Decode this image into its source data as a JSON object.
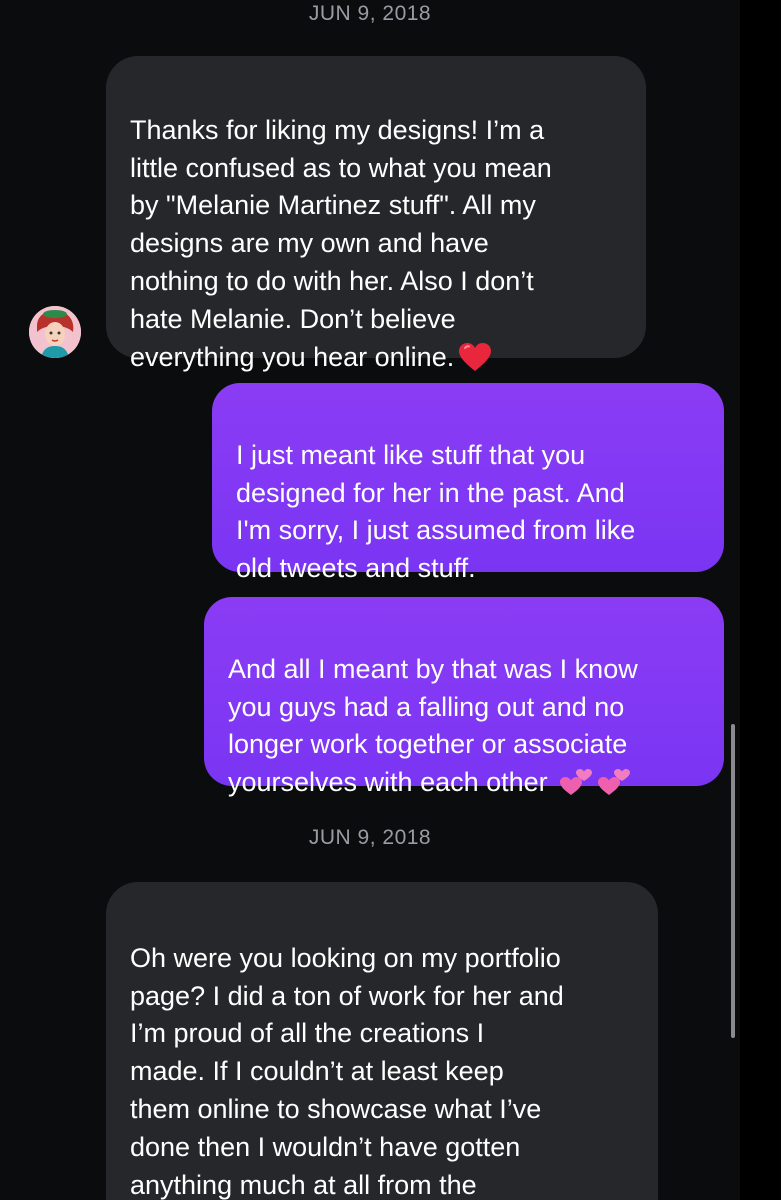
{
  "conversation": {
    "dates": [
      "JUN 9, 2018",
      "JUN 9, 2018"
    ],
    "messages": [
      {
        "direction": "incoming",
        "text": "Thanks for liking my designs! I’m a\nlittle confused as to what you mean\nby \"Melanie Martinez stuff\". All my\ndesigns are my own and have\nnothing to do with her. Also I don’t\nhate Melanie. Don’t believe\neverything you hear online.",
        "emoji": "red-heart"
      },
      {
        "direction": "outgoing",
        "text": "I just meant like stuff that you\ndesigned for her in the past. And\nI'm sorry, I just assumed from like\nold tweets and stuff."
      },
      {
        "direction": "outgoing",
        "text": "And all I meant by that was I know\nyou guys had a falling out and no\nlonger work together or associate\nyourselves with each other",
        "emoji": "two-hearts two-hearts"
      },
      {
        "direction": "incoming",
        "text": "Oh were you looking on my portfolio\npage? I did a ton of work for her and\nI’m proud of all the creations I\nmade. If I couldn’t at least keep\nthem online to showcase what I’ve\ndone then I wouldn’t have gotten\nanything  much at all from the\nexperience haha. I no longer want to"
      }
    ]
  },
  "colors": {
    "background": "#0b0c0e",
    "incoming_bubble": "#26272b",
    "outgoing_bubble": "#8037f4",
    "date_text": "#9a9ca3"
  },
  "icons": [
    "contact-avatar",
    "red-heart-emoji",
    "two-hearts-emoji"
  ]
}
